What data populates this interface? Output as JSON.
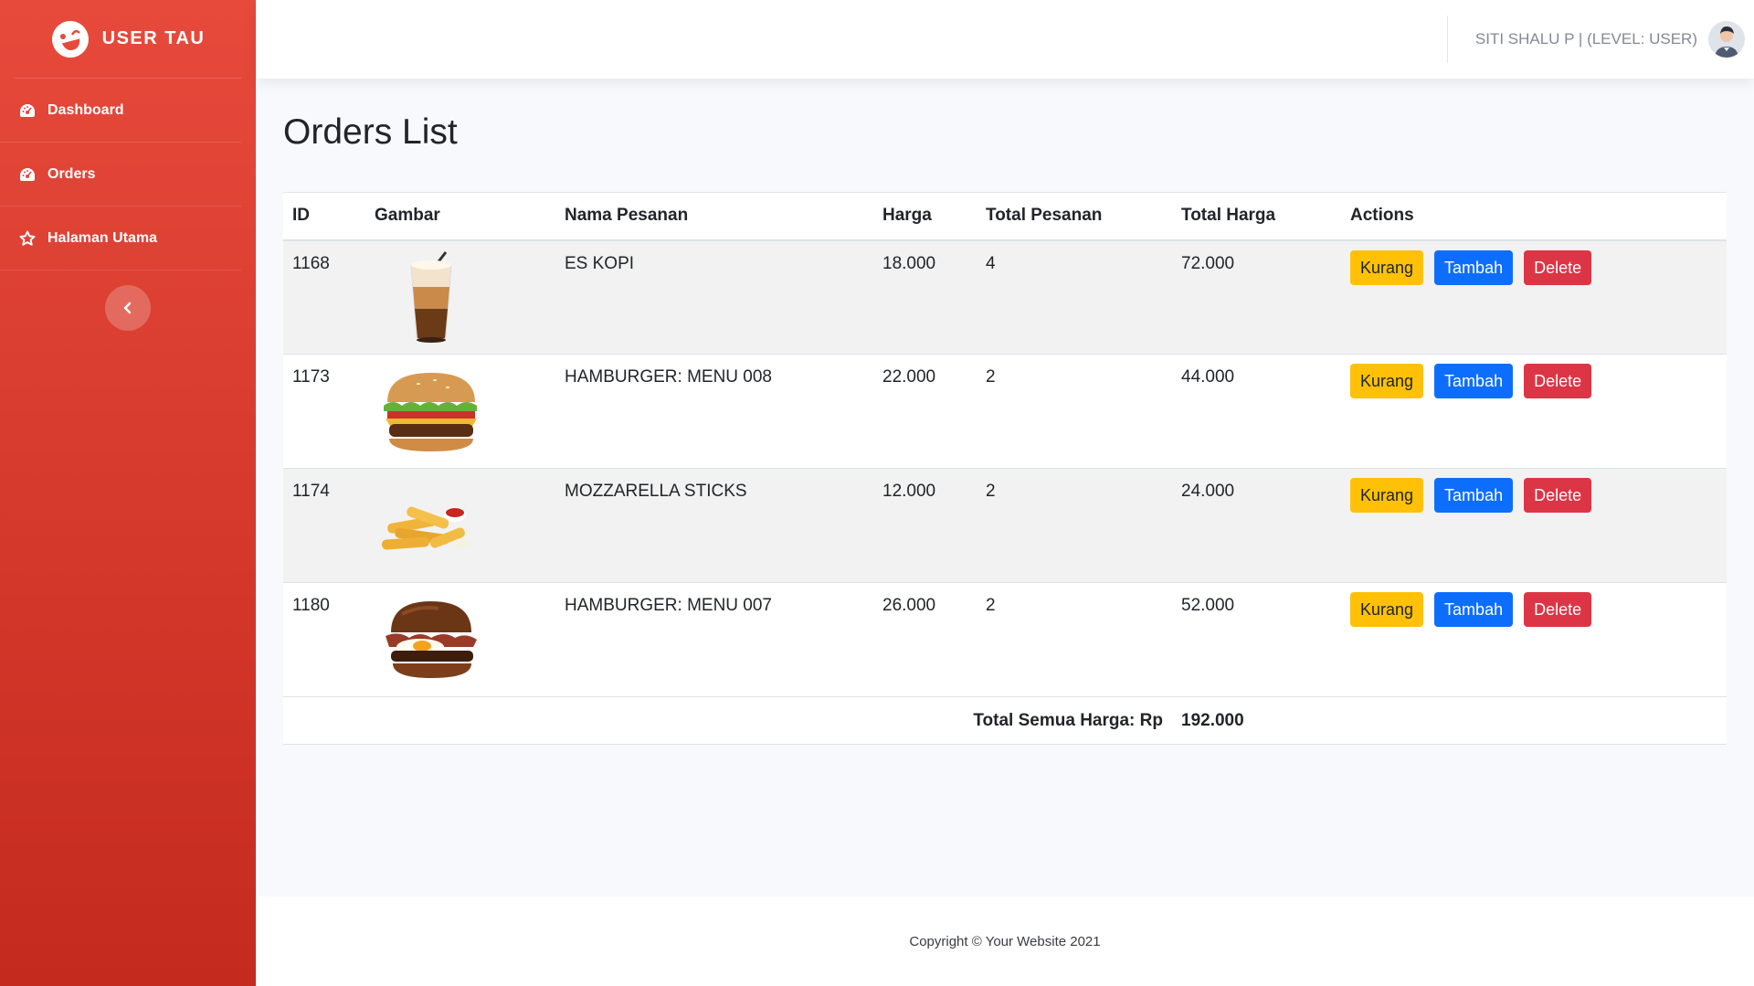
{
  "sidebar": {
    "brand": "USER TAU",
    "items": [
      {
        "label": "Dashboard",
        "icon": "tachometer-icon"
      },
      {
        "label": "Orders",
        "icon": "tachometer-icon"
      },
      {
        "label": "Halaman Utama",
        "icon": "star-icon"
      }
    ],
    "toggle_icon": "chevron-left-icon"
  },
  "topbar": {
    "user_label": "SITI SHALU P | (LEVEL: USER)"
  },
  "main": {
    "title": "Orders List",
    "columns": [
      "ID",
      "Gambar",
      "Nama Pesanan",
      "Harga",
      "Total Pesanan",
      "Total Harga",
      "Actions"
    ],
    "rows": [
      {
        "id": "1168",
        "image": "iced-coffee-image",
        "name": "ES KOPI",
        "price": "18.000",
        "qty": "4",
        "total": "72.000"
      },
      {
        "id": "1173",
        "image": "burger-image",
        "name": "HAMBURGER: MENU 008",
        "price": "22.000",
        "qty": "2",
        "total": "44.000"
      },
      {
        "id": "1174",
        "image": "mozzarella-sticks-image",
        "name": "MOZZARELLA STICKS",
        "price": "12.000",
        "qty": "2",
        "total": "24.000"
      },
      {
        "id": "1180",
        "image": "burger-egg-image",
        "name": "HAMBURGER: MENU 007",
        "price": "26.000",
        "qty": "2",
        "total": "52.000"
      }
    ],
    "actions": {
      "decrease": "Kurang",
      "increase": "Tambah",
      "delete": "Delete"
    },
    "total_label": "Total Semua Harga: Rp",
    "total_value": "192.000"
  },
  "footer": {
    "copyright": "Copyright © Your Website 2021"
  },
  "colors": {
    "sidebar_top": "#e74a3b",
    "sidebar_bottom": "#c42a1e",
    "warning": "#ffc107",
    "primary": "#0d6efd",
    "danger": "#dc3545"
  }
}
